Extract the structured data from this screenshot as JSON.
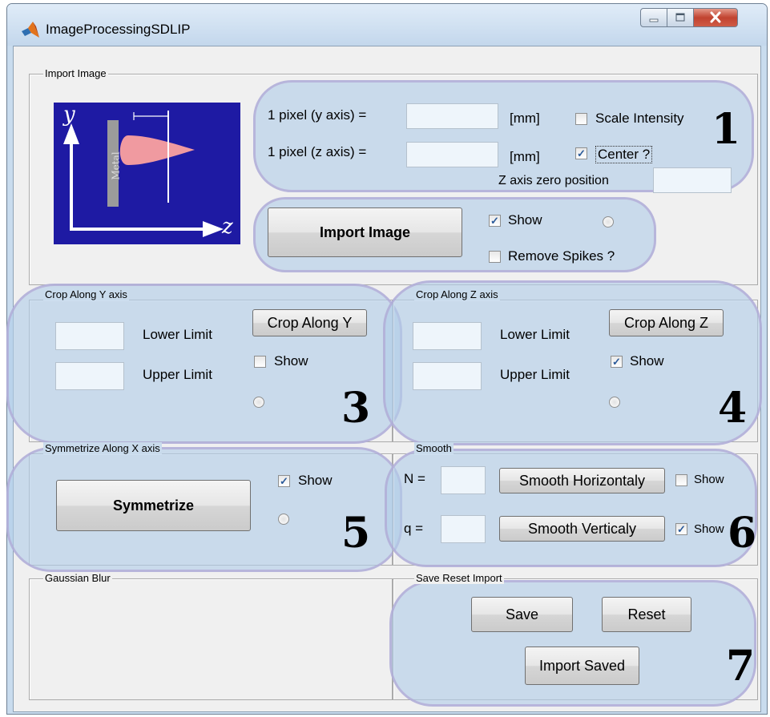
{
  "window": {
    "title": "ImageProcessingSDLIP"
  },
  "import_image": {
    "title": "Import Image",
    "diagram": {
      "y_label": "y",
      "z_label": "z",
      "metal_label": "Metal"
    },
    "pixel_y_label": "1 pixel (y axis) =",
    "pixel_z_label": "1 pixel (z axis) =",
    "unit_y": "[mm]",
    "unit_z": "[mm]",
    "scale_intensity": {
      "label": "Scale Intensity",
      "checked": false
    },
    "center": {
      "label": "Center ?",
      "checked": true
    },
    "z_zero_label": "Z axis zero position",
    "import_button": "Import Image",
    "show": {
      "label": "Show",
      "checked": true
    },
    "remove_spikes": {
      "label": "Remove Spikes ?",
      "checked": false
    },
    "region_number": "1"
  },
  "crop_y": {
    "title": "Crop Along Y axis",
    "lower_label": "Lower Limit",
    "upper_label": "Upper Limit",
    "button": "Crop Along Y",
    "show": {
      "label": "Show",
      "checked": false
    },
    "region_number": "3"
  },
  "crop_z": {
    "title": "Crop Along Z axis",
    "lower_label": "Lower Limit",
    "upper_label": "Upper Limit",
    "button": "Crop Along Z",
    "show": {
      "label": "Show",
      "checked": true
    },
    "region_number": "4"
  },
  "symmetrize": {
    "title": "Symmetrize Along X axis",
    "button": "Symmetrize",
    "show": {
      "label": "Show",
      "checked": true
    },
    "region_number": "5"
  },
  "smooth": {
    "title": "Smooth",
    "n_label": "N =",
    "q_label": "q =",
    "horizontal_button": "Smooth Horizontaly",
    "vertical_button": "Smooth Verticaly",
    "show_h": {
      "label": "Show",
      "checked": false
    },
    "show_v": {
      "label": "Show",
      "checked": true
    },
    "region_number": "6"
  },
  "gaussian": {
    "title": "Gaussian Blur"
  },
  "save_reset": {
    "title": "Save Reset Import",
    "save_button": "Save",
    "reset_button": "Reset",
    "import_saved_button": "Import Saved",
    "region_number": "7"
  },
  "colors": {
    "accent_blob": "#b2cde8",
    "blob_border": "#b2a8d6",
    "diagram_bg": "#1e1aa3",
    "droplet": "#f09aa0"
  }
}
